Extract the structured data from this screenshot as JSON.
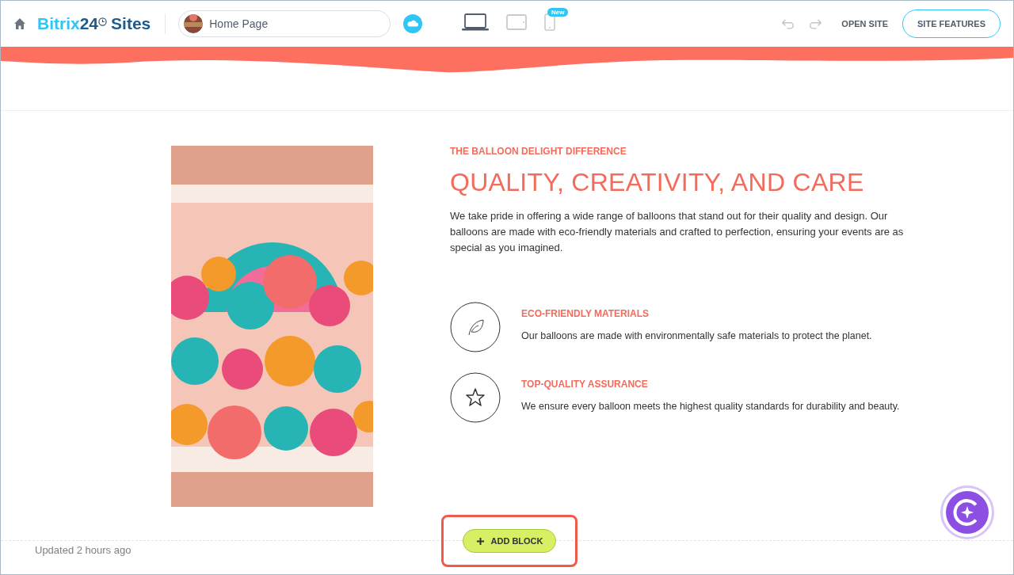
{
  "header": {
    "logo": {
      "brand": "Bitrix",
      "number": "24",
      "product": "Sites"
    },
    "page_selector": {
      "value": "Home Page"
    },
    "devices": [
      {
        "kind": "laptop",
        "selected": true
      },
      {
        "kind": "tablet",
        "selected": false
      },
      {
        "kind": "phone",
        "selected": false,
        "badge": "New"
      }
    ],
    "open_site": "OPEN SITE",
    "site_features": "SITE FEATURES"
  },
  "section": {
    "eyebrow": "THE BALLOON DELIGHT DIFFERENCE",
    "title": "QUALITY, CREATIVITY, AND CARE",
    "body": "We take pride in offering a wide range of balloons that stand out for their quality and design. Our balloons are made with eco-friendly materials and crafted to perfection, ensuring your events are as special as you imagined.",
    "features": [
      {
        "kind": "leaf",
        "title": "ECO-FRIENDLY MATERIALS",
        "text": "Our balloons are made with environmentally safe materials to protect the planet."
      },
      {
        "kind": "star",
        "title": "TOP-QUALITY ASSURANCE",
        "text": "We ensure every balloon meets the highest quality standards for durability and beauty."
      }
    ]
  },
  "footer": {
    "updated": "Updated 2 hours ago",
    "add_block": {
      "label": "ADD BLOCK",
      "highlighted": true
    }
  }
}
